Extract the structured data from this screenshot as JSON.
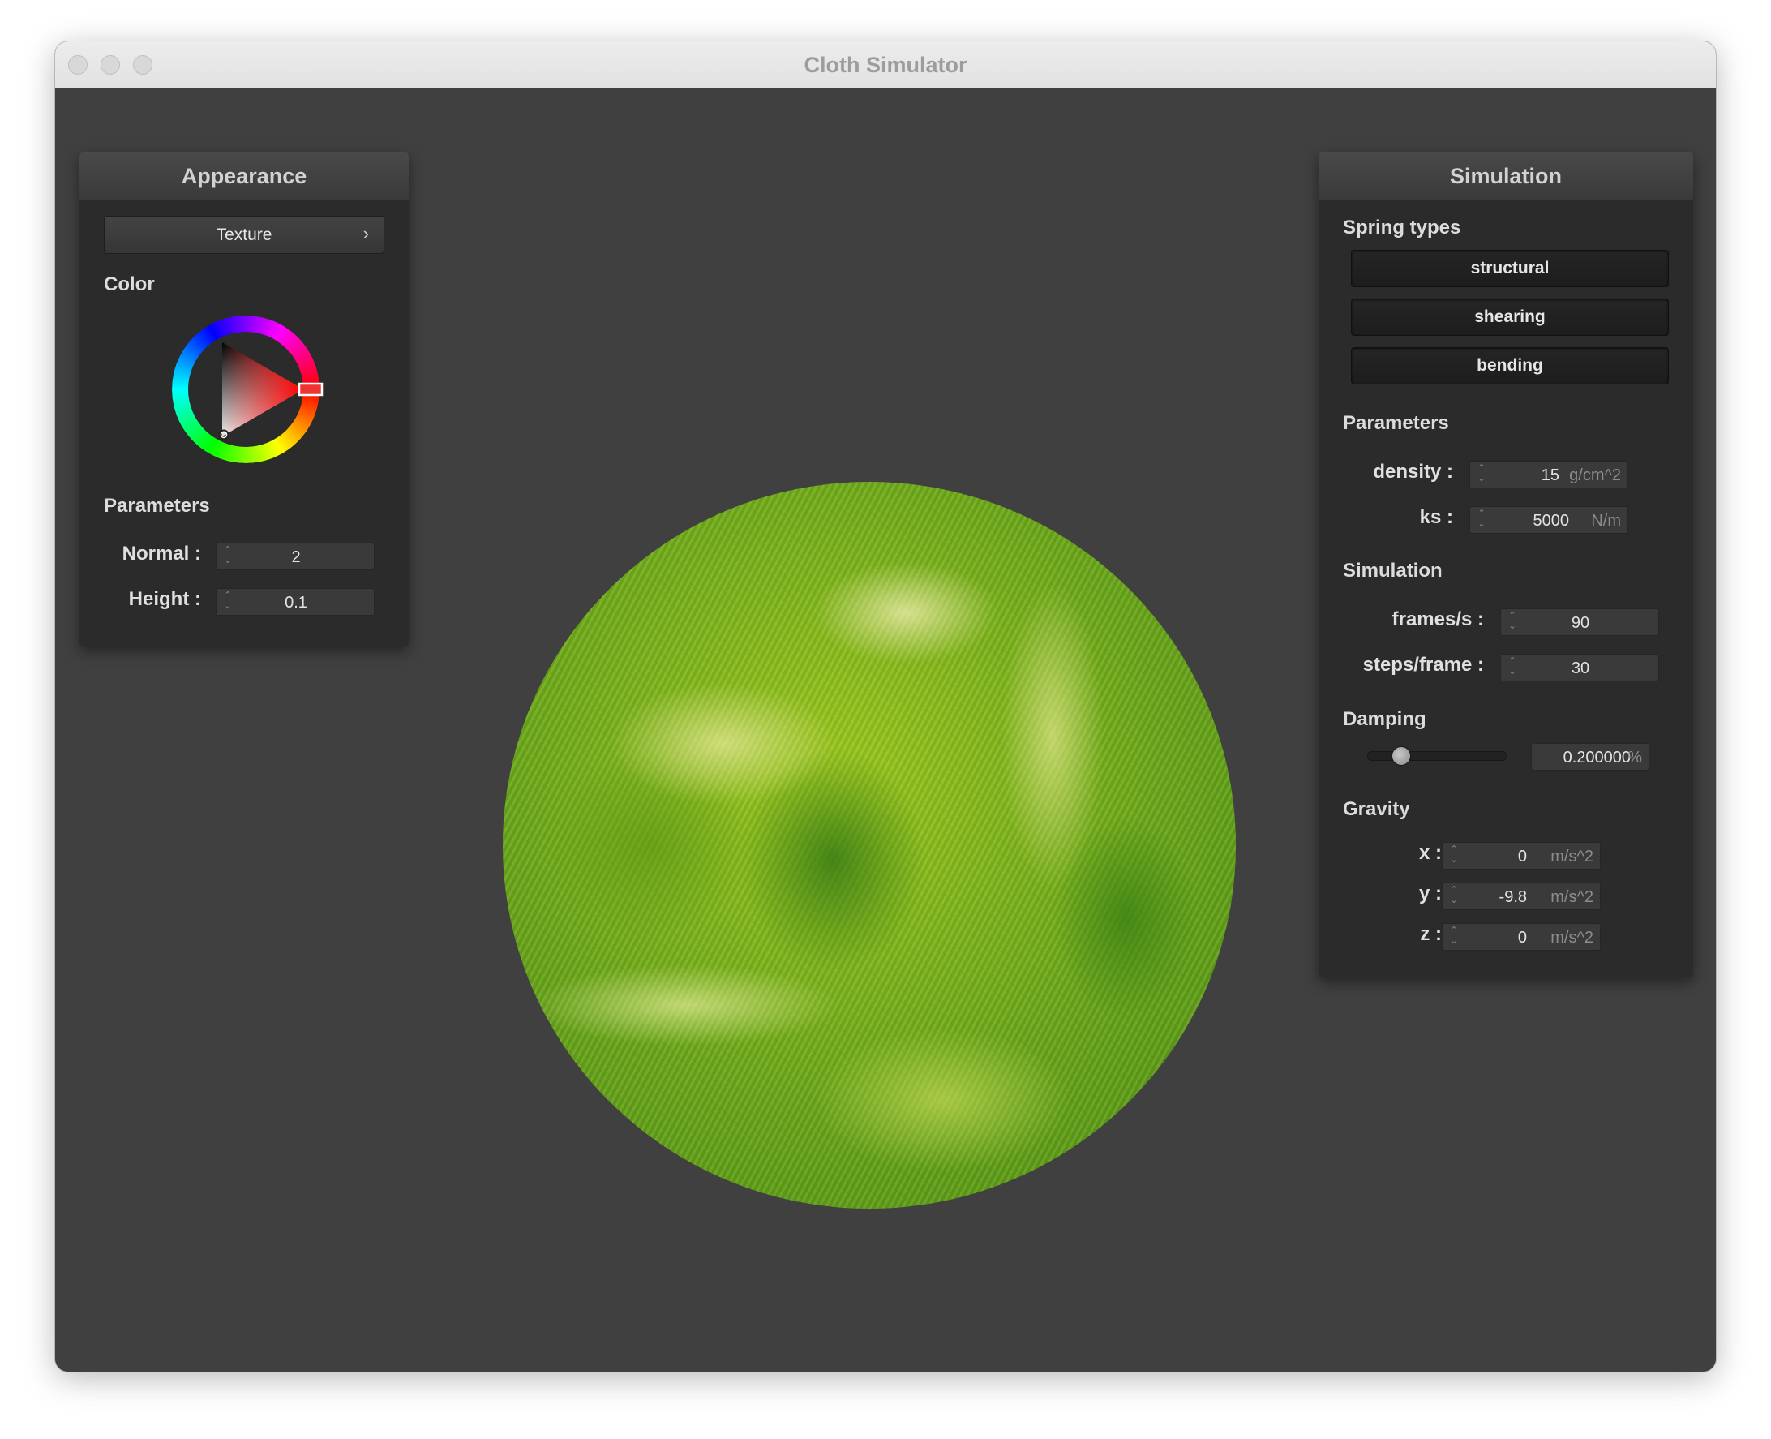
{
  "window": {
    "title": "Cloth Simulator"
  },
  "appearance": {
    "title": "Appearance",
    "texture_button": "Texture",
    "texture_chevron": "›",
    "color_label": "Color",
    "selected_color": "#ff0000",
    "parameters_label": "Parameters",
    "normal": {
      "label": "Normal :",
      "value": "2"
    },
    "height": {
      "label": "Height :",
      "value": "0.1"
    }
  },
  "simulation_panel": {
    "title": "Simulation",
    "spring_types_label": "Spring types",
    "spring_types": [
      "structural",
      "shearing",
      "bending"
    ],
    "parameters_label": "Parameters",
    "density": {
      "label": "density :",
      "value": "15",
      "unit": "g/cm^2"
    },
    "ks": {
      "label": "ks :",
      "value": "5000",
      "unit": "N/m"
    },
    "simulation_label": "Simulation",
    "frames": {
      "label": "frames/s :",
      "value": "90"
    },
    "steps": {
      "label": "steps/frame :",
      "value": "30"
    },
    "damping_label": "Damping",
    "damping": {
      "value": "0.200000",
      "unit": "%",
      "slider_fraction": 0.2
    },
    "gravity_label": "Gravity",
    "gravity": {
      "x": {
        "label": "x :",
        "value": "0",
        "unit": "m/s^2"
      },
      "y": {
        "label": "y :",
        "value": "-9.8",
        "unit": "m/s^2"
      },
      "z": {
        "label": "z :",
        "value": "0",
        "unit": "m/s^2"
      }
    }
  },
  "colors": {
    "viewport_bg": "#404040",
    "panel_bg": "#2b2b2b",
    "sphere_texture": "#7bb31c"
  }
}
